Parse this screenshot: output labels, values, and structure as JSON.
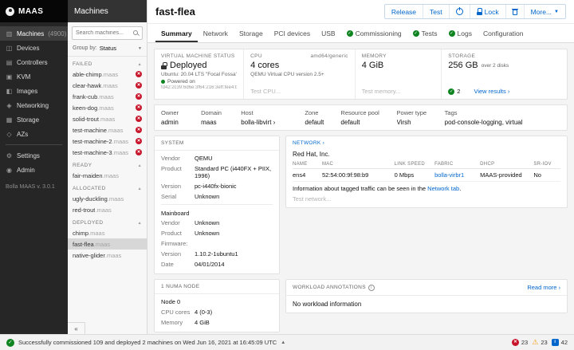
{
  "app": {
    "logo_text": "MAAS",
    "version": "Bolla MAAS v. 3.0.1"
  },
  "nav": {
    "items": [
      {
        "label": "Machines",
        "count": "(4900)"
      },
      {
        "label": "Devices"
      },
      {
        "label": "Controllers"
      },
      {
        "label": "KVM"
      },
      {
        "label": "Images"
      },
      {
        "label": "Networking"
      },
      {
        "label": "Storage"
      },
      {
        "label": "AZs"
      },
      {
        "label": "Settings"
      },
      {
        "label": "Admin"
      }
    ]
  },
  "machines_panel": {
    "title": "Machines",
    "search_placeholder": "Search machines...",
    "group_by_label": "Group by:",
    "group_by_value": "Status",
    "domain_suffix": ".maas",
    "collapse_label": "«",
    "groups": [
      {
        "label": "FAILED"
      },
      {
        "label": "READY"
      },
      {
        "label": "ALLOCATED"
      },
      {
        "label": "DEPLOYED"
      }
    ],
    "failed": [
      {
        "name": "able-chimp"
      },
      {
        "name": "clear-hawk"
      },
      {
        "name": "frank-cub"
      },
      {
        "name": "keen-dog"
      },
      {
        "name": "solid-trout"
      },
      {
        "name": "test-machine"
      },
      {
        "name": "test-machine-2"
      },
      {
        "name": "test-machine-3"
      }
    ],
    "ready": [
      {
        "name": "fair-maiden"
      }
    ],
    "allocated": [
      {
        "name": "ugly-duckling"
      },
      {
        "name": "red-trout"
      }
    ],
    "deployed": [
      {
        "name": "chimp"
      },
      {
        "name": "fast-flea"
      },
      {
        "name": "native-glider"
      }
    ]
  },
  "header": {
    "title": "fast-flea",
    "release": "Release",
    "test": "Test",
    "lock": "Lock",
    "more": "More..."
  },
  "tabs": {
    "items": [
      {
        "label": "Summary"
      },
      {
        "label": "Network"
      },
      {
        "label": "Storage"
      },
      {
        "label": "PCI devices"
      },
      {
        "label": "USB"
      },
      {
        "label": "Commissioning"
      },
      {
        "label": "Tests"
      },
      {
        "label": "Logs"
      },
      {
        "label": "Configuration"
      }
    ]
  },
  "summary": {
    "vm_status": {
      "label": "VIRTUAL MACHINE STATUS",
      "value": "Deployed",
      "os": "Ubuntu: 20.04 LTS \"Focal Fossa\"",
      "power": "Powered on",
      "address": "fd42:2c39:6d6e:3f64:216:3eff:fee4:b18d"
    },
    "cpu": {
      "label": "CPU",
      "arch": "amd64/generic",
      "value": "4 cores",
      "model": "QEMU Virtual CPU version 2.5+",
      "action": "Test CPU..."
    },
    "memory": {
      "label": "MEMORY",
      "value": "4 GiB",
      "action": "Test memory..."
    },
    "storage": {
      "label": "STORAGE",
      "value": "256 GB",
      "detail": "over 2 disks",
      "passed_count": "2",
      "action": "View results ›"
    },
    "details": [
      {
        "label": "Owner",
        "value": "admin"
      },
      {
        "label": "Domain",
        "value": "maas"
      },
      {
        "label": "Host",
        "value": "bolla-libvirt ›"
      },
      {
        "label": "Zone",
        "value": "default"
      },
      {
        "label": "Resource pool",
        "value": "default"
      },
      {
        "label": "Power type",
        "value": "Virsh"
      },
      {
        "label": "Tags",
        "value": "pod-console-logging, virtual"
      }
    ],
    "system": {
      "title": "SYSTEM",
      "rows": [
        {
          "label": "Vendor",
          "value": "QEMU"
        },
        {
          "label": "Product",
          "value": "Standard PC (i440FX + PIIX, 1996)"
        },
        {
          "label": "Version",
          "value": "pc-i440fx-bionic"
        },
        {
          "label": "Serial",
          "value": "Unknown"
        }
      ],
      "mainboard_title": "Mainboard",
      "mainboard_rows": [
        {
          "label": "Vendor",
          "value": "Unknown"
        },
        {
          "label": "Product",
          "value": "Unknown"
        }
      ],
      "firmware_label": "Firmware:",
      "firmware_rows": [
        {
          "label": "Version",
          "value": "1.10.2-1ubuntu1"
        },
        {
          "label": "Date",
          "value": "04/01/2014"
        }
      ]
    },
    "network": {
      "title": "NETWORK ›",
      "vendor": "Red Hat, Inc.",
      "headers": [
        "NAME",
        "MAC",
        "LINK SPEED",
        "FABRIC",
        "DHCP",
        "SR-IOV"
      ],
      "row": {
        "name": "ens4",
        "mac": "52:54:00:9f:98:b9",
        "link_speed": "0 Mbps",
        "fabric": "bolla-virbr1",
        "dhcp": "MAAS-provided",
        "sriov": "No"
      },
      "note_before": "Information about tagged traffic can be seen in the ",
      "note_link": "Network tab",
      "note_after": ".",
      "action": "Test network..."
    },
    "numa": {
      "title": "1 NUMA NODE",
      "node": "Node 0",
      "rows": [
        {
          "label": "CPU cores",
          "value": "4 (0-3)"
        },
        {
          "label": "Memory",
          "value": "4 GiB"
        }
      ]
    },
    "workload": {
      "title": "WORKLOAD ANNOTATIONS",
      "read_more": "Read more ›",
      "empty": "No workload information"
    }
  },
  "footer": {
    "message": "Successfully commissioned 109 and deployed 2 machines on Wed Jun 16, 2021 at 16:45:09 UTC",
    "error_count": "23",
    "warning_count": "23",
    "notification_count": "42"
  }
}
